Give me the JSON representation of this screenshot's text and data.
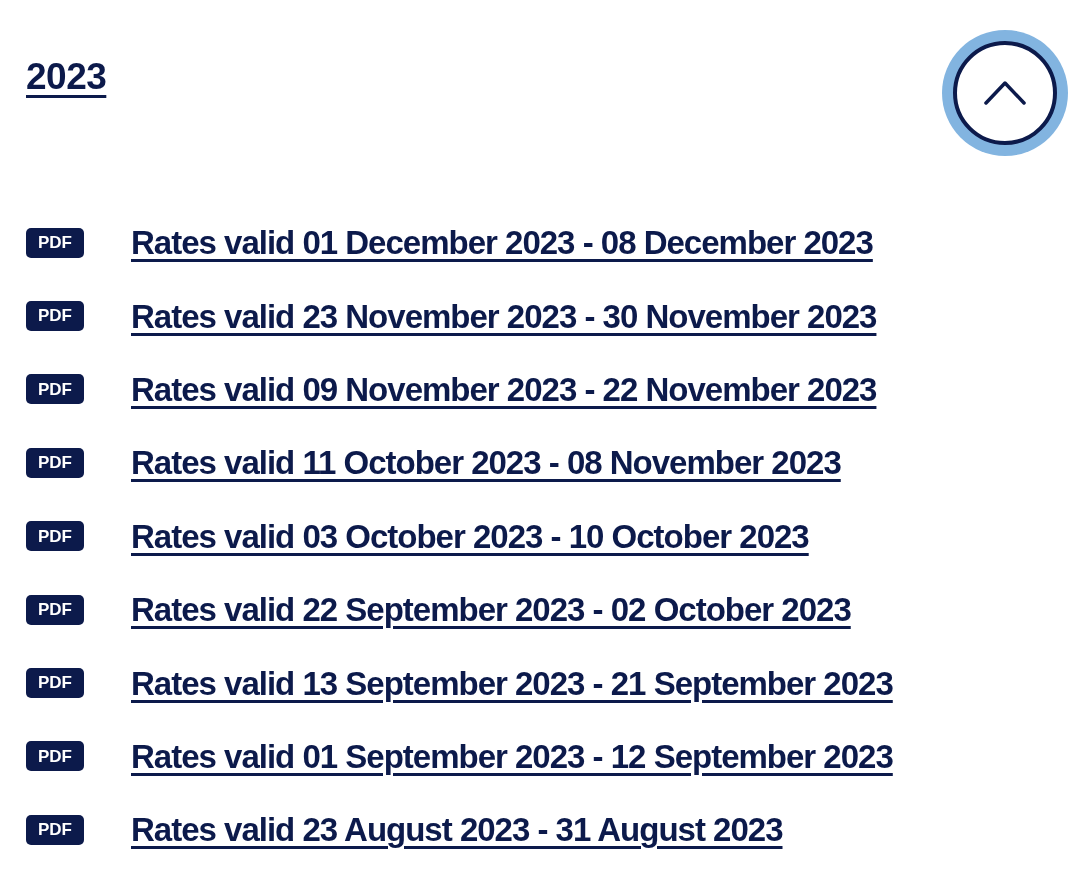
{
  "section": {
    "heading": "2023",
    "expanded": true
  },
  "documents": [
    {
      "badge": "PDF",
      "label": "Rates valid 01 December 2023 - 08 December 2023"
    },
    {
      "badge": "PDF",
      "label": "Rates valid 23 November 2023 - 30 November 2023"
    },
    {
      "badge": "PDF",
      "label": "Rates valid 09 November 2023 - 22 November 2023"
    },
    {
      "badge": "PDF",
      "label": "Rates valid 11 October 2023 - 08 November 2023"
    },
    {
      "badge": "PDF",
      "label": "Rates valid 03 October 2023 - 10 October 2023"
    },
    {
      "badge": "PDF",
      "label": "Rates valid 22 September 2023 - 02 October 2023"
    },
    {
      "badge": "PDF",
      "label": "Rates valid 13 September 2023 - 21 September 2023"
    },
    {
      "badge": "PDF",
      "label": "Rates valid 01 September 2023 - 12 September 2023"
    },
    {
      "badge": "PDF",
      "label": "Rates valid 23 August 2023 - 31 August 2023"
    }
  ]
}
